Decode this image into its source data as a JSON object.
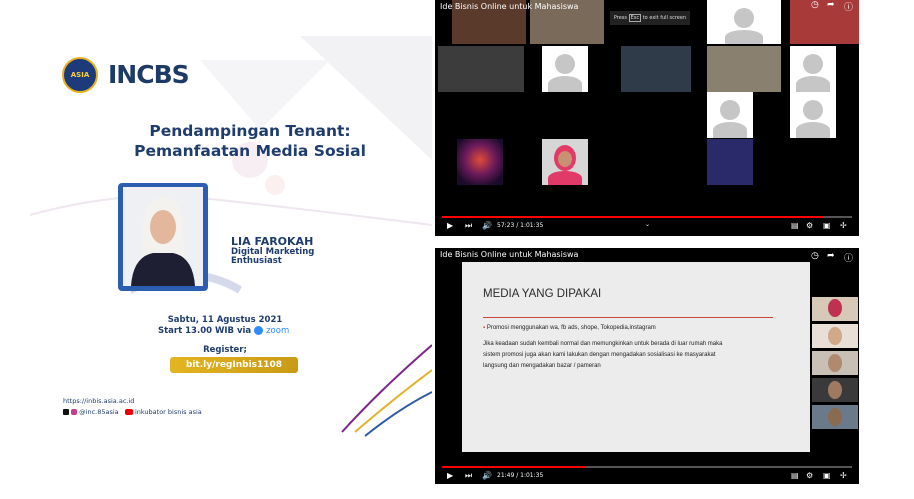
{
  "poster": {
    "logo_asia_text": "ASIA",
    "logo_incbs": "INCBS",
    "title_line1": "Pendampingan Tenant:",
    "title_line2": "Pemanfaatan Media Sosial",
    "speaker_name": "LIA FAROKAH",
    "speaker_role_line1": "Digital Marketing",
    "speaker_role_line2": "Enthusiast",
    "date": "Sabtu, 11 Agustus 2021",
    "time_prefix": "Start 13.00 WIB via",
    "zoom": "zoom",
    "register_label": "Register;",
    "register_link": "bit.ly/regInbis1108",
    "website": "https://inbis.asia.ac.id",
    "social_handle": "@inc.85asia",
    "youtube_channel": "inkubator bisnis asia"
  },
  "video_top": {
    "title": "Ide Bisnis Online untuk Mahasiswa",
    "fullscreen_hint_pre": "Press",
    "fullscreen_hint_key": "Esc",
    "fullscreen_hint_post": "to exit full screen",
    "time": "57:23 / 1:01:35",
    "progress": 0.93
  },
  "video_bottom": {
    "title": "Ide Bisnis Online untuk Mahasiswa",
    "time": "21:49 / 1:01:35",
    "progress": 0.35,
    "slide": {
      "heading": "MEDIA YANG DIPAKAI",
      "bullet": "Promosi menggunakan wa, fb ads, shope, Tokopedia,instagram",
      "para1": "Jika keadaan sudah kembali normal dan memungkinkan untuk berada di luar rumah maka",
      "para2": "sistem promosi juga akan kami lakukan dengan mengadakan sosialisasi ke masyarakat",
      "para3": "langsung dan mengadakan bazar / pameran"
    }
  },
  "colors": {
    "navy": "#1f3c6e",
    "gold": "#d8a91b",
    "youtube_red": "#ff0000"
  }
}
